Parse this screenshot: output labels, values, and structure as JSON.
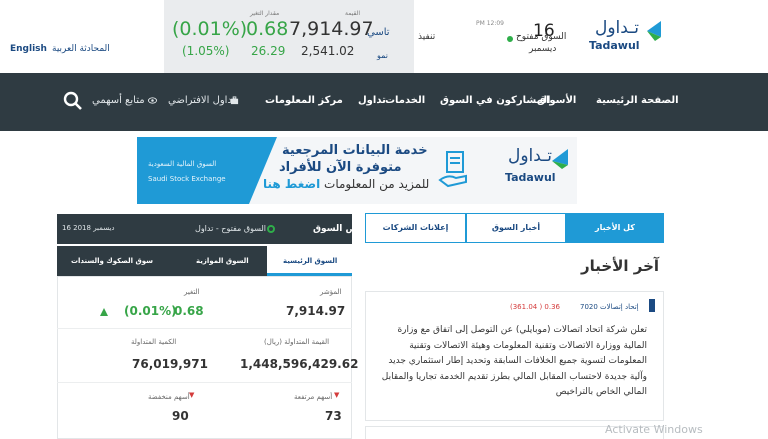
{
  "lang": {
    "english": "English",
    "arabic": "المحادثة العربية"
  },
  "ticker": {
    "pct_head": "مقدار التغير",
    "pct": "(0.01%)",
    "pct2": "(1.05%)",
    "chg": "0.68",
    "chg2": "26.29",
    "idx_head": "القيمة",
    "idx": "7,914.97",
    "idx2": "2,541.02",
    "name1": "تاسي",
    "name2": "نمو"
  },
  "market": {
    "time": "PM 12:09",
    "status": "تنفيذ",
    "state": "السوق مفتوح",
    "day": "16",
    "month": "ديسمبر"
  },
  "logo": {
    "ar": "تـداول",
    "en": "Tadawul"
  },
  "nav": {
    "items": [
      "الصفحة الرئيسية",
      "الأسواق",
      "المشاركون في السوق",
      "الخدمات",
      "تداول",
      "مركز المعلومات"
    ],
    "virtual": "تداول الافتراضي",
    "stocks": "متابع أسهمي"
  },
  "banner": {
    "small1": "السوق المالية السعودية",
    "small2": "Saudi Stock Exchange",
    "t1": "خدمة البيانات المرجعية",
    "t2": "متوفرة الآن للأفراد",
    "t3_pre": "للمزيد من المعلومات ",
    "t3_link": "اضغط هنا",
    "logo_ar": "تـداول",
    "logo_en": "Tadawul"
  },
  "summary": {
    "title": "ملخص السوق",
    "state": "السوق مفتوح - تداول",
    "date": "16 ديسمبر 2018",
    "tabs": [
      "السوق الرئيسية",
      "السوق الموازية",
      "سوق الصكوك والسندات"
    ],
    "index_label": "المؤشر",
    "index_value": "7,914.97",
    "change_label": "التغير",
    "change_value": "0.68",
    "change_pct": "(0.01%)",
    "value_label": "القيمة المتداولة (ريال)",
    "value_value": "1,448,596,429.62",
    "volume_label": "الكمية المتداولة",
    "volume_value": "76,019,971",
    "up_label": "أسهم مرتفعة",
    "up_value": "73",
    "down_label": "أسهم منخفضة",
    "down_value": "90"
  },
  "news": {
    "tabs": [
      "كل الأخبار",
      "أخبار السوق",
      "إعلانات الشركات"
    ],
    "title": "آخر الأخبار",
    "company": "7020 إتحاد إتصالات",
    "price": "(361.04 ) 0.36",
    "body": "تعلن شركة اتحاد اتصالات (موبايلي) عن التوصل إلى اتفاق مع وزارة المالية ووزارة الاتصالات وتقنية المعلومات وهيئة الاتصالات وتقنية المعلومات لتسوية جميع الخلافات السابقة وتحديد إطار استثماري جديد وآلية جديدة لاحتساب المقابل المالي بطرز تقديم الخدمة تجاريا والمقابل المالي الخاص بالتراخيص"
  },
  "watermark": "Activate Windows",
  "colors": {
    "nav": "#2f3b42",
    "accent": "#1f9ad6",
    "brand": "#1b4a82",
    "up": "#37a548",
    "down": "#d43b3b"
  }
}
